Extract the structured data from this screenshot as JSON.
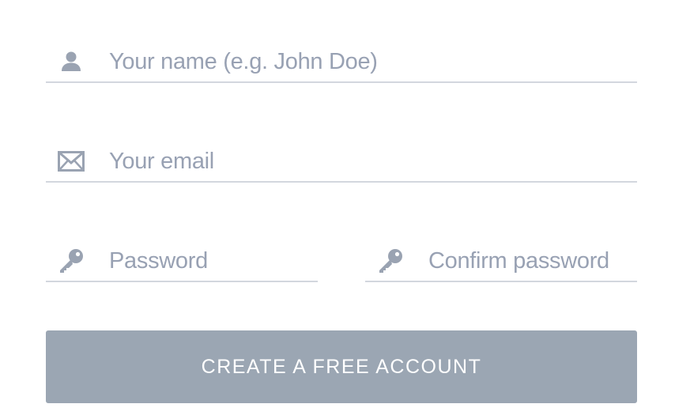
{
  "form": {
    "name_field": {
      "placeholder": "Your name (e.g. John Doe)",
      "icon": "user-icon"
    },
    "email_field": {
      "placeholder": "Your email",
      "icon": "envelope-icon"
    },
    "password_field": {
      "placeholder": "Password",
      "icon": "key-icon"
    },
    "confirm_field": {
      "placeholder": "Confirm password",
      "icon": "key-icon"
    },
    "submit_label": "CREATE A FREE ACCOUNT"
  },
  "colors": {
    "icon": "#9aa3b2",
    "placeholder": "#98a1b3",
    "underline": "#d3d7de",
    "button_bg": "#9ba6b3",
    "button_text": "#ffffff"
  }
}
